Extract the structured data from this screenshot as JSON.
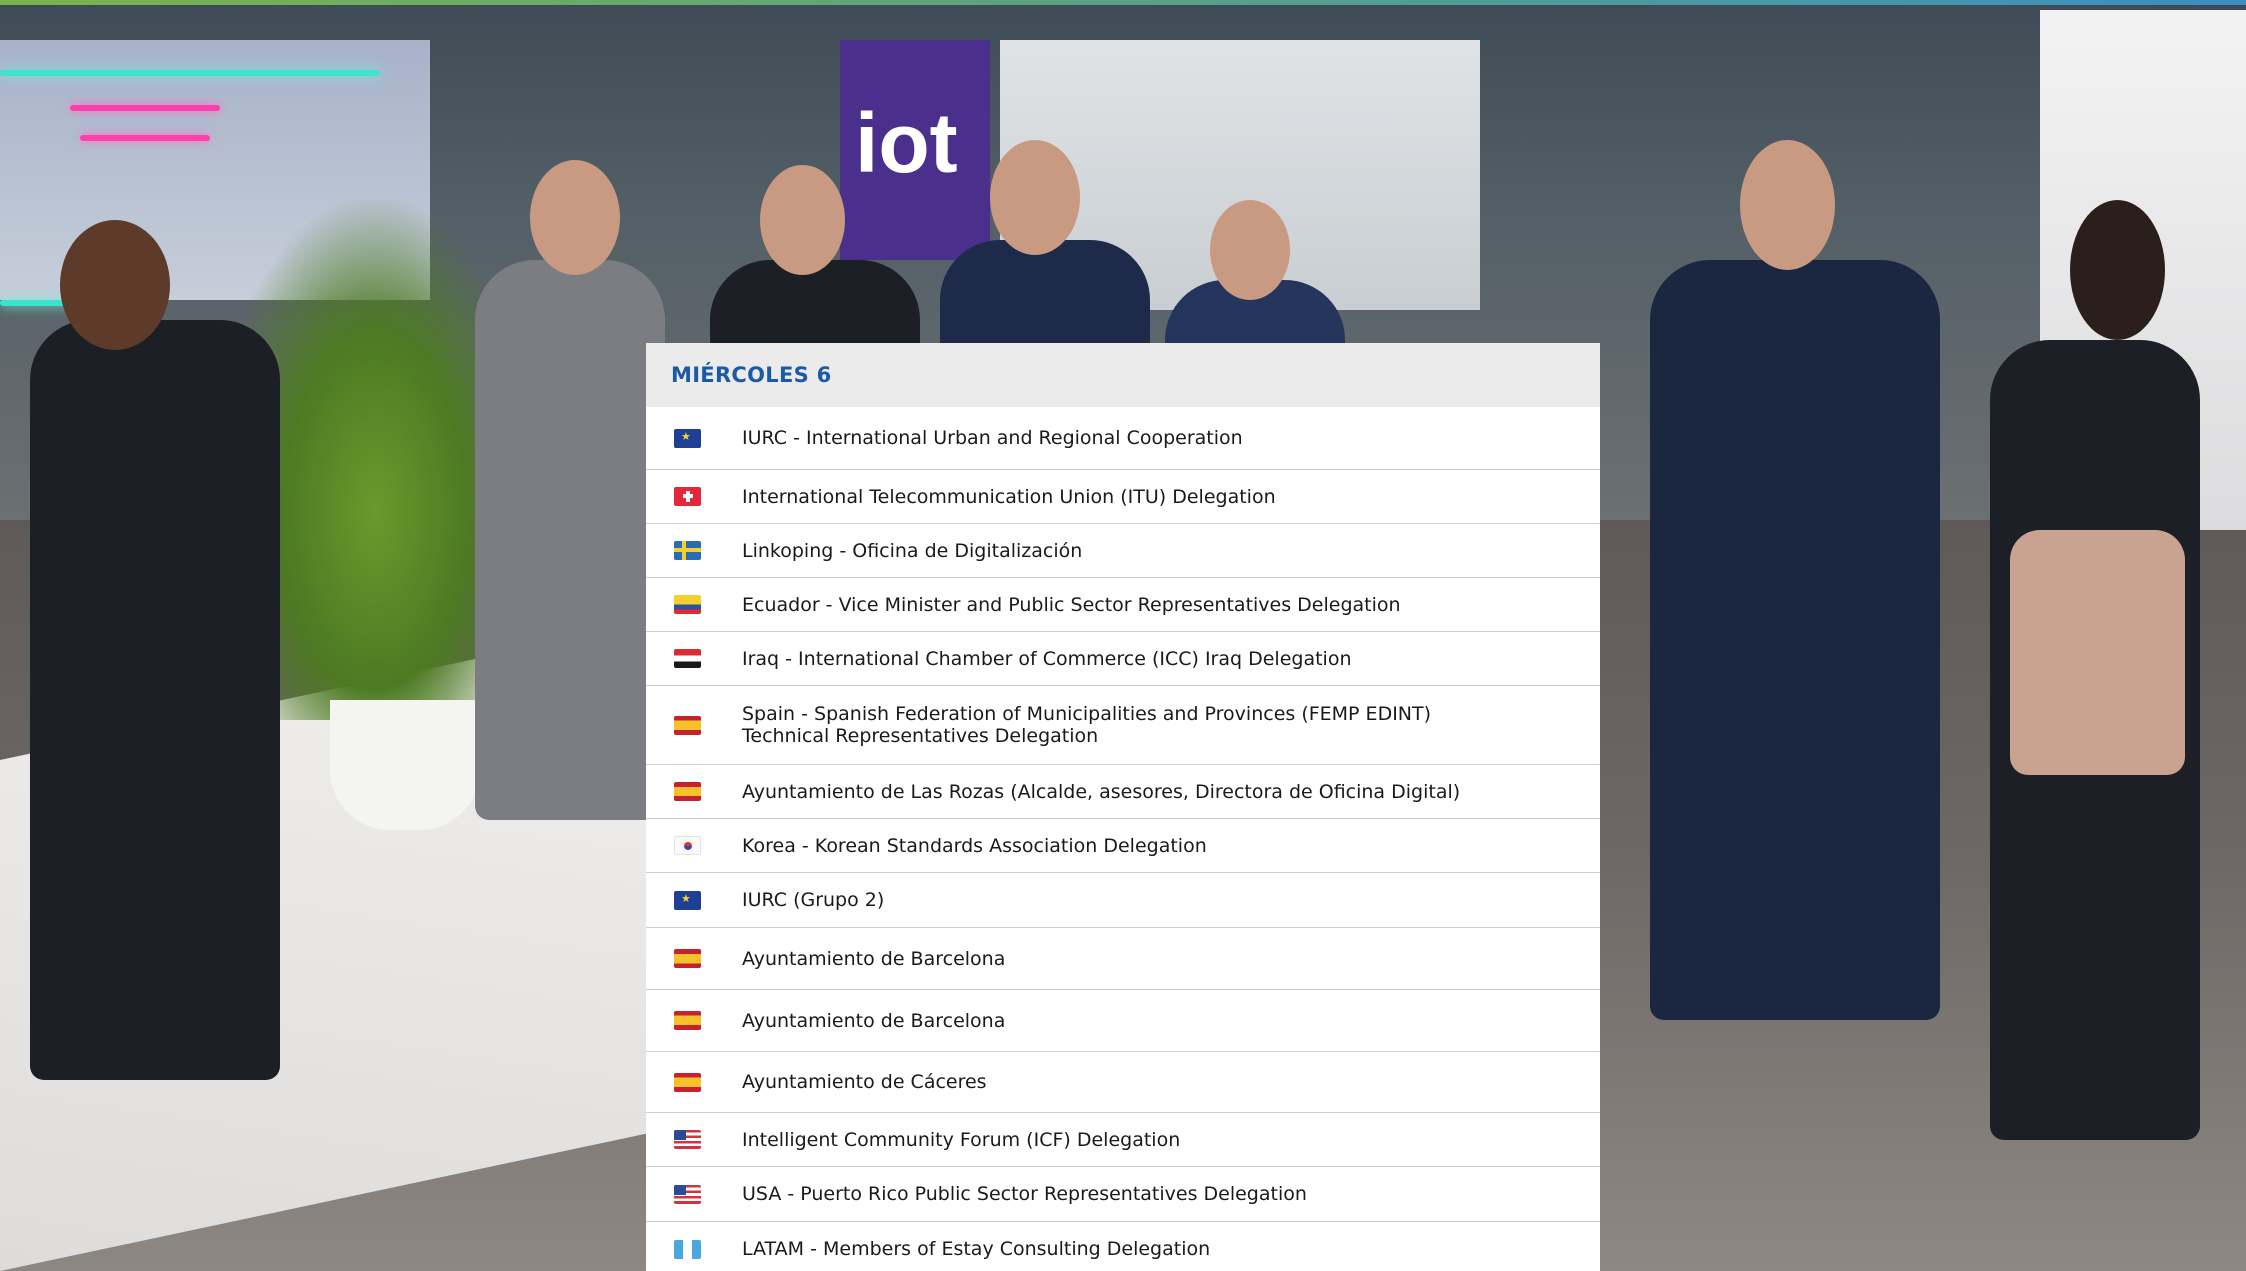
{
  "schedule": {
    "day_title": "MIÉRCOLES  6",
    "entries": [
      {
        "flag_icon": "eu-flag-icon",
        "label": "IURC - International Urban and Regional Cooperation"
      },
      {
        "flag_icon": "switzerland-flag-icon",
        "label": "International Telecommunication Union (ITU) Delegation"
      },
      {
        "flag_icon": "sweden-flag-icon",
        "label": "Linkoping - Oficina de Digitalización"
      },
      {
        "flag_icon": "ecuador-flag-icon",
        "label": "Ecuador - Vice Minister and Public Sector Representatives Delegation"
      },
      {
        "flag_icon": "iraq-flag-icon",
        "label": "Iraq - International Chamber of Commerce (ICC) Iraq Delegation"
      },
      {
        "flag_icon": "spain-flag-icon",
        "label": "Spain - Spanish Federation of Municipalities and Provinces (FEMP EDINT) Technical Representatives Delegation"
      },
      {
        "flag_icon": "spain-flag-icon",
        "label": "Ayuntamiento de Las Rozas (Alcalde, asesores, Directora de Oficina Digital)"
      },
      {
        "flag_icon": "korea-flag-icon",
        "label": "Korea - Korean Standards Association Delegation"
      },
      {
        "flag_icon": "eu-flag-icon",
        "label": "IURC (Grupo 2)"
      },
      {
        "flag_icon": "spain-flag-icon",
        "label": "Ayuntamiento de Barcelona"
      },
      {
        "flag_icon": "spain-flag-icon",
        "label": "Ayuntamiento de Barcelona"
      },
      {
        "flag_icon": "spain-flag-icon",
        "label": "Ayuntamiento de Cáceres"
      },
      {
        "flag_icon": "usa-flag-icon",
        "label": "Intelligent Community Forum (ICF) Delegation"
      },
      {
        "flag_icon": "usa-flag-icon",
        "label": "USA - Puerto Rico Public Sector Representatives Delegation"
      },
      {
        "flag_icon": "latam-flag-icon",
        "label": "LATAM - Members of Estay Consulting Delegation"
      }
    ]
  },
  "background": {
    "booth_sign": "iot",
    "colors": {
      "accent_blue": "#1d5aa5",
      "booth_purple": "#4a2f8d",
      "neon_pink": "#ff3fae",
      "neon_teal": "#3de3cc"
    }
  }
}
